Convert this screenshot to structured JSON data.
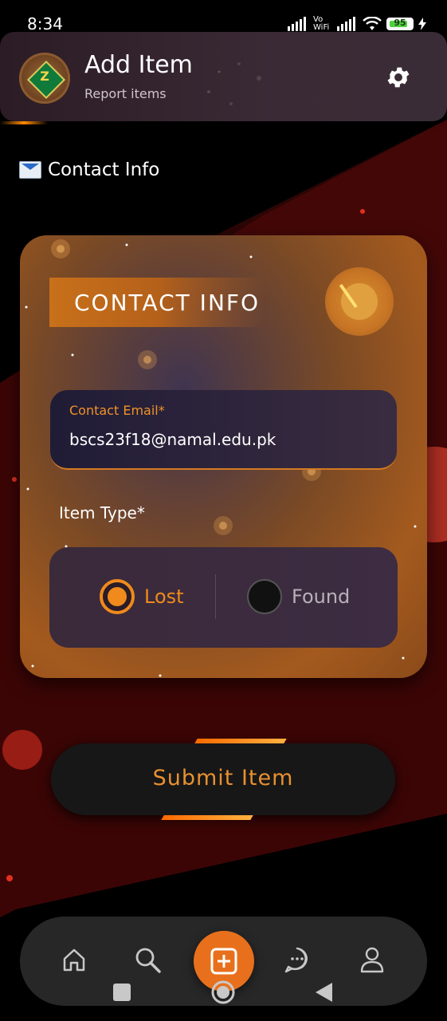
{
  "status_bar": {
    "time": "8:34",
    "network": "Vo WiFi",
    "battery": "95"
  },
  "header": {
    "logo_letter": "Z",
    "title": "Add Item",
    "subtitle": "Report items"
  },
  "section": {
    "label": "Contact Info"
  },
  "card": {
    "title": "CONTACT INFO",
    "email": {
      "label": "Contact Email*",
      "value": "bscs23f18@namal.edu.pk"
    },
    "item_type": {
      "label": "Item Type*",
      "options": [
        "Lost",
        "Found"
      ],
      "selected": "Lost"
    }
  },
  "submit": {
    "label": "Submit Item"
  },
  "bottom_nav": {
    "items": [
      "home-icon",
      "search-icon",
      "add-icon",
      "chat-icon",
      "profile-icon"
    ]
  },
  "colors": {
    "accent": "#f08a1c",
    "background": "#000000",
    "header_bg": "#3a2a35",
    "card_orange": "#a45a1e"
  }
}
